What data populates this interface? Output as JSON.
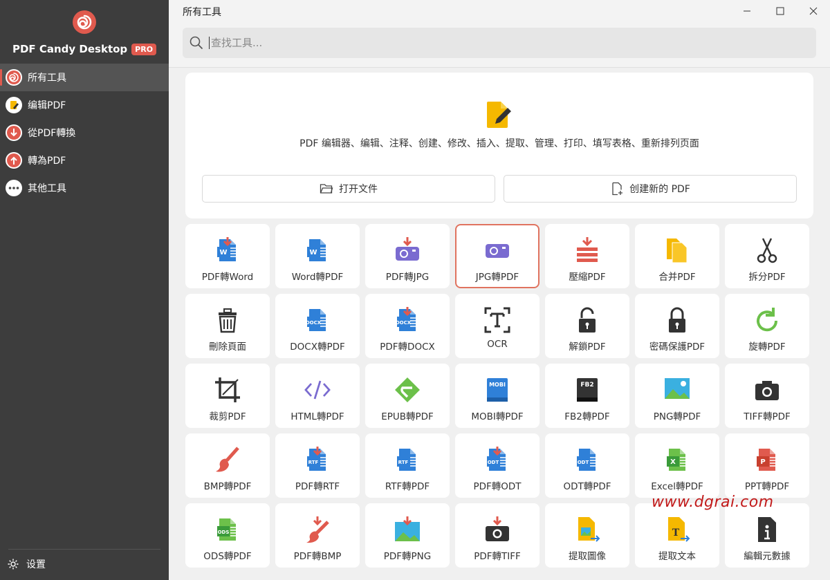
{
  "app": {
    "brand": "PDF Candy Desktop",
    "badge": "PRO",
    "accent": "#e05a4e"
  },
  "sidebar": {
    "items": [
      {
        "label": "所有工具",
        "icon": "spiral-icon",
        "active": true
      },
      {
        "label": "编辑PDF",
        "icon": "pencil-icon",
        "active": false
      },
      {
        "label": "從PDF轉換",
        "icon": "arrow-down-icon",
        "active": false
      },
      {
        "label": "轉為PDF",
        "icon": "arrow-up-icon",
        "active": false
      },
      {
        "label": "其他工具",
        "icon": "more-dots-icon",
        "active": false
      }
    ],
    "settings_label": "设置"
  },
  "header": {
    "title": "所有工具",
    "search_placeholder": "查找工具..."
  },
  "editor": {
    "description": "PDF 编辑器、编辑、注释、创建、修改、插入、提取、管理、打印、填写表格、重新排列页面",
    "open_label": "打开文件",
    "create_label": "创建新的 PDF"
  },
  "tools": [
    {
      "label": "PDF轉Word",
      "icon": "pdf-to-word-icon"
    },
    {
      "label": "Word轉PDF",
      "icon": "word-icon"
    },
    {
      "label": "PDF轉JPG",
      "icon": "pdf-to-jpg-icon"
    },
    {
      "label": "JPG轉PDF",
      "icon": "jpg-icon"
    },
    {
      "label": "壓縮PDF",
      "icon": "compress-icon"
    },
    {
      "label": "合并PDF",
      "icon": "merge-icon"
    },
    {
      "label": "拆分PDF",
      "icon": "scissors-icon"
    },
    {
      "label": "刪除頁面",
      "icon": "trash-icon"
    },
    {
      "label": "DOCX轉PDF",
      "icon": "docx-icon"
    },
    {
      "label": "PDF轉DOCX",
      "icon": "pdf-to-docx-icon"
    },
    {
      "label": "OCR",
      "icon": "ocr-icon"
    },
    {
      "label": "解鎖PDF",
      "icon": "unlock-icon"
    },
    {
      "label": "密碼保護PDF",
      "icon": "lock-icon"
    },
    {
      "label": "旋轉PDF",
      "icon": "rotate-icon"
    },
    {
      "label": "裁剪PDF",
      "icon": "crop-icon"
    },
    {
      "label": "HTML轉PDF",
      "icon": "html-icon"
    },
    {
      "label": "EPUB轉PDF",
      "icon": "epub-icon"
    },
    {
      "label": "MOBI轉PDF",
      "icon": "mobi-icon"
    },
    {
      "label": "FB2轉PDF",
      "icon": "fb2-icon"
    },
    {
      "label": "PNG轉PDF",
      "icon": "png-icon"
    },
    {
      "label": "TIFF轉PDF",
      "icon": "tiff-icon"
    },
    {
      "label": "BMP轉PDF",
      "icon": "bmp-icon"
    },
    {
      "label": "PDF轉RTF",
      "icon": "pdf-to-rtf-icon"
    },
    {
      "label": "RTF轉PDF",
      "icon": "rtf-icon"
    },
    {
      "label": "PDF轉ODT",
      "icon": "pdf-to-odt-icon"
    },
    {
      "label": "ODT轉PDF",
      "icon": "odt-icon"
    },
    {
      "label": "Excel轉PDF",
      "icon": "excel-icon"
    },
    {
      "label": "PPT轉PDF",
      "icon": "ppt-icon"
    },
    {
      "label": "ODS轉PDF",
      "icon": "ods-icon"
    },
    {
      "label": "PDF轉BMP",
      "icon": "pdf-to-bmp-icon"
    },
    {
      "label": "PDF轉PNG",
      "icon": "pdf-to-png-icon"
    },
    {
      "label": "PDF轉TIFF",
      "icon": "pdf-to-tiff-icon"
    },
    {
      "label": "提取圖像",
      "icon": "extract-image-icon"
    },
    {
      "label": "提取文本",
      "icon": "extract-text-icon"
    },
    {
      "label": "編輯元數據",
      "icon": "metadata-icon"
    }
  ],
  "selected_tool": "JPG轉PDF",
  "watermark": "www.dgrai.com"
}
